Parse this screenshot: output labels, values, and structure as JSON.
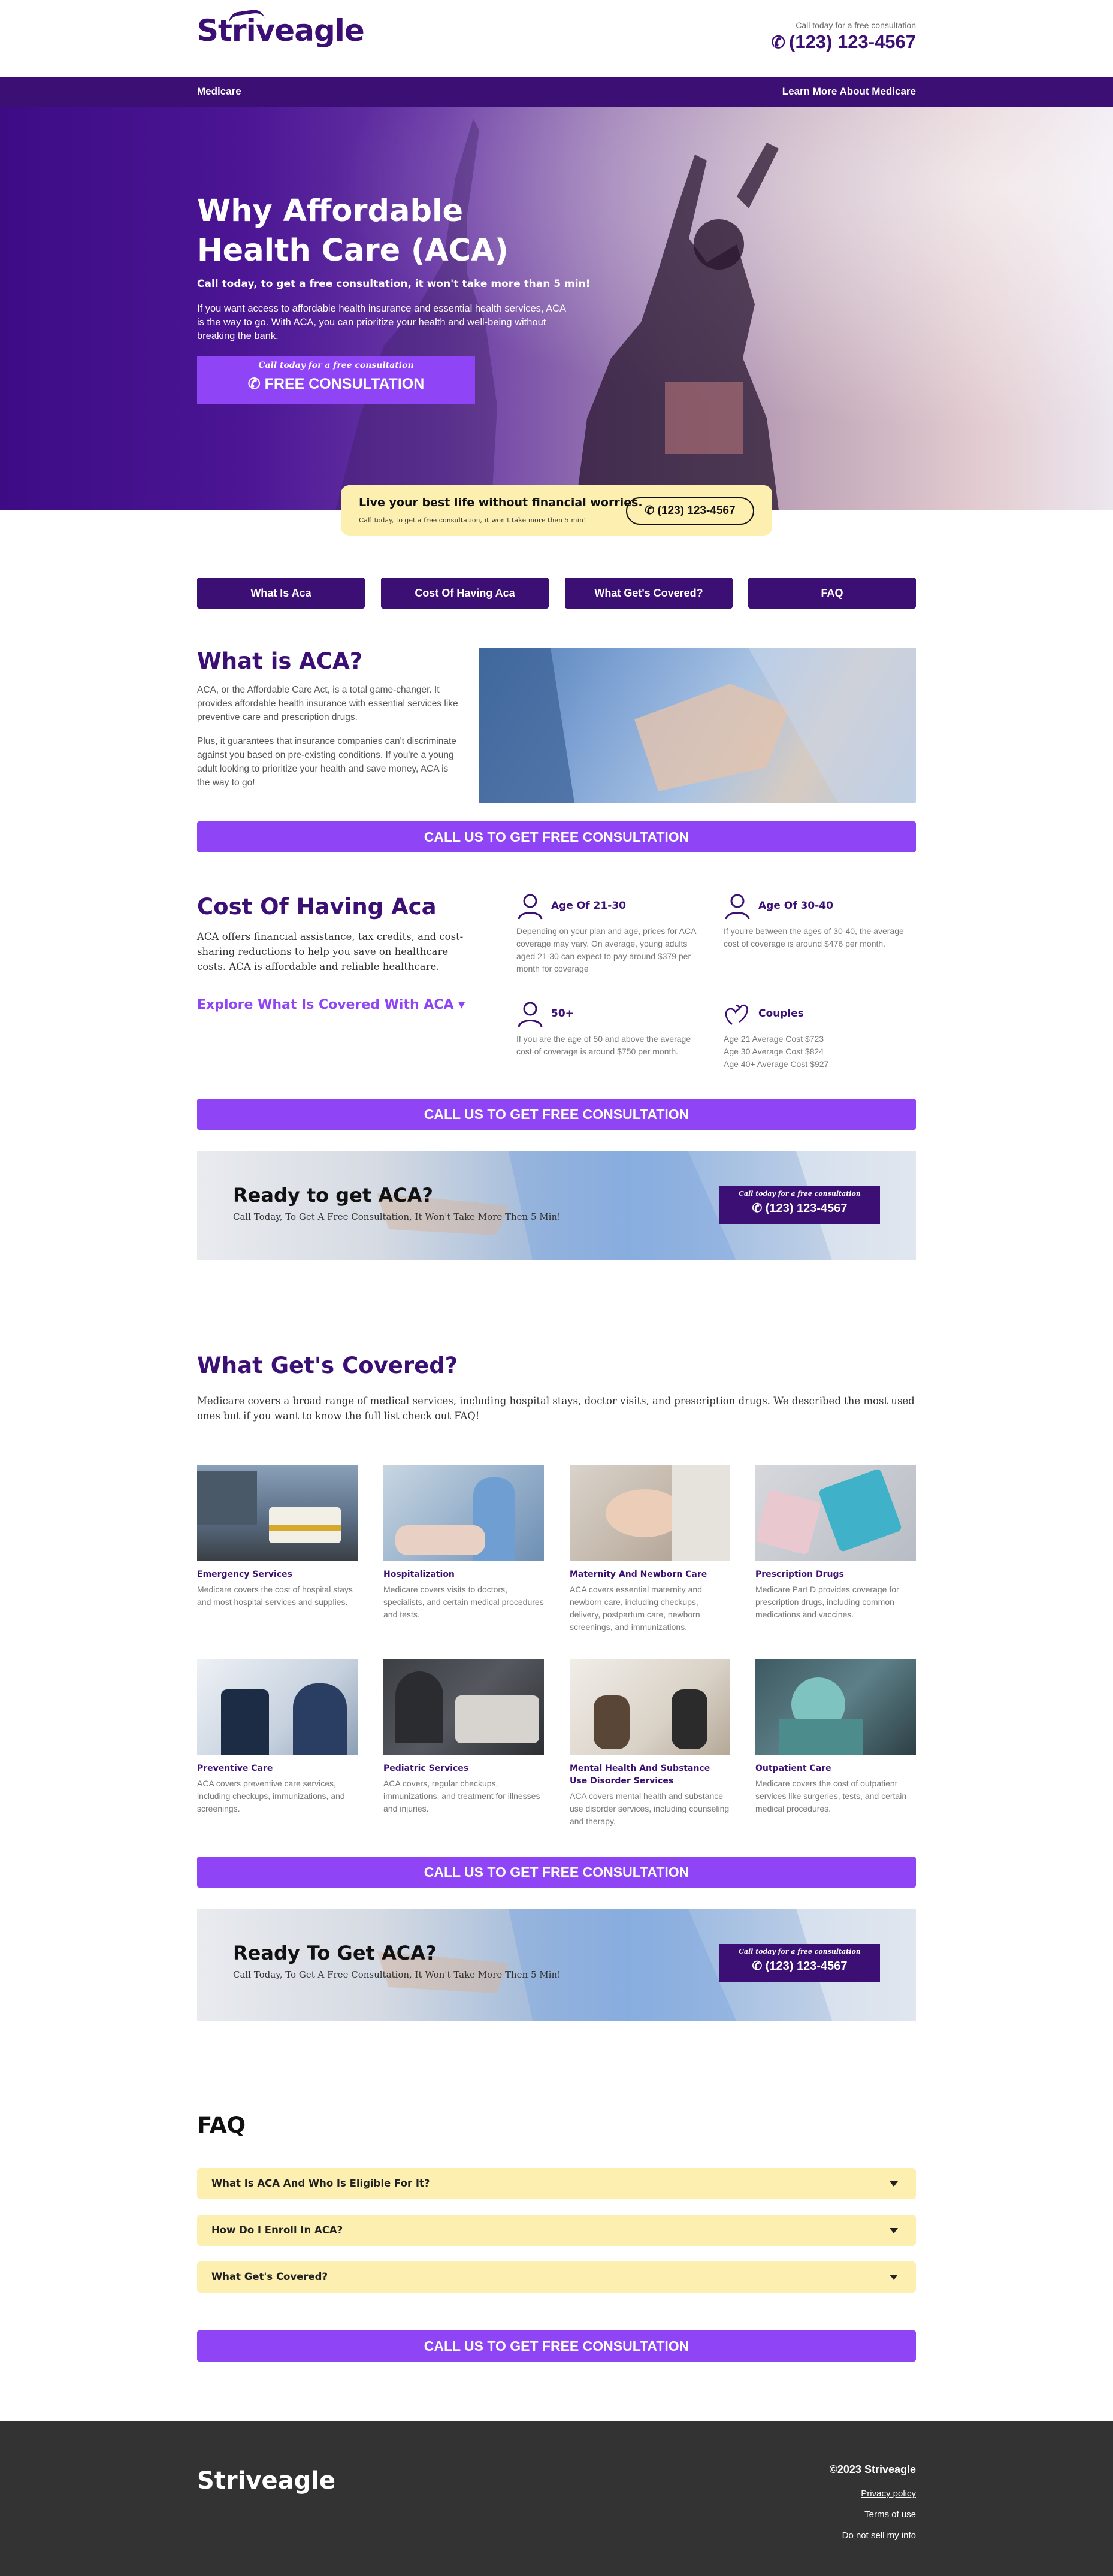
{
  "header": {
    "logo": "Striveagle",
    "call_text": "Call today for a free consultation",
    "phone": "(123) 123-4567"
  },
  "nav": {
    "left": "Medicare",
    "right": "Learn More About Medicare"
  },
  "hero": {
    "title": "Why Affordable Health Care (ACA)",
    "subtitle": "Call today, to get a free consultation, it won't take more than 5 min!",
    "body": "If you want access to affordable health insurance and essential health services, ACA is the way to go. With ACA, you can prioritize your health and well-being without breaking the bank.",
    "btn_top": "Call today for a free consultation",
    "btn_main": "FREE CONSULTATION"
  },
  "callout": {
    "title": "Live your best life without financial worries.",
    "sub": "Call today, to get a free consultation, it won't take more then 5 min!",
    "phone": "(123) 123-4567"
  },
  "tabs": [
    "What Is Aca",
    "Cost Of Having Aca",
    "What Get's Covered?",
    "FAQ"
  ],
  "what_is": {
    "title": "What is ACA?",
    "p1": "ACA, or the Affordable Care Act, is a total game-changer. It provides affordable health insurance with essential services like preventive care and prescription drugs.",
    "p2": "Plus, it guarantees that insurance companies can't discriminate against you based on pre-existing conditions. If you're a young adult looking to prioritize your health and save money, ACA is the way to go!"
  },
  "cta_label": "CALL US TO GET FREE CONSULTATION",
  "cost": {
    "title": "Cost Of Having Aca",
    "body": "ACA offers financial assistance, tax credits, and cost-sharing reductions to help you save on healthcare costs. ACA is affordable and reliable healthcare.",
    "explore": "Explore What Is Covered With ACA",
    "ages": [
      {
        "title": "Age Of 21-30",
        "desc": "Depending on your plan and age, prices for ACA coverage may vary. On average, young adults aged 21-30 can expect to pay around $379 per month for coverage",
        "icon": "person-icon"
      },
      {
        "title": "Age Of 30-40",
        "desc": "If you're between the ages of 30-40, the average cost of coverage is around $476 per month.",
        "icon": "person-icon"
      },
      {
        "title": "50+",
        "desc": "If you are the age of 50 and above the average cost of coverage is around $750 per month.",
        "icon": "person-icon"
      },
      {
        "title": "Couples",
        "desc1": "Age 21 Average Cost $723",
        "desc2": "Age 30 Average Cost $824",
        "desc3": "Age 40+ Average Cost $927",
        "icon": "hearts-icon"
      }
    ]
  },
  "banner1": {
    "title": "Ready to get ACA?",
    "sub": "Call Today, To Get A Free Consultation, It Won't Take More Then 5 Min!",
    "btn_top": "Call today for a free consultation",
    "btn_phone": "(123) 123-4567"
  },
  "covered": {
    "title": "What Get's Covered?",
    "body": "Medicare covers a broad range of medical services, including hospital stays, doctor visits, and prescription drugs. We described the most used ones but if you want to know the full list check out FAQ!",
    "items": [
      {
        "title": "Emergency Services",
        "desc": "Medicare covers the cost of hospital stays and most hospital services and supplies."
      },
      {
        "title": "Hospitalization",
        "desc": "Medicare covers visits to doctors, specialists, and certain medical procedures and tests."
      },
      {
        "title": "Maternity And Newborn Care",
        "desc": "ACA covers essential maternity and newborn care, including checkups, delivery, postpartum care, newborn screenings, and immunizations."
      },
      {
        "title": "Prescription Drugs",
        "desc": "Medicare Part D provides coverage for prescription drugs, including common medications and vaccines."
      },
      {
        "title": "Preventive Care",
        "desc": "ACA covers preventive care services, including checkups, immunizations, and screenings."
      },
      {
        "title": "Pediatric Services",
        "desc": "ACA covers, regular checkups, immunizations, and treatment for illnesses and injuries."
      },
      {
        "title": "Mental Health And Substance Use Disorder Services",
        "desc": "ACA covers mental health and substance use disorder services, including counseling and therapy."
      },
      {
        "title": "Outpatient Care",
        "desc": "Medicare covers the cost of outpatient services like surgeries, tests, and certain medical procedures."
      }
    ]
  },
  "banner2": {
    "title": "Ready To Get ACA?",
    "sub": "Call Today, To Get A Free Consultation, It Won't Take More Then 5 Min!",
    "btn_top": "Call today for a free consultation",
    "btn_phone": "(123) 123-4567"
  },
  "faq": {
    "title": "FAQ",
    "items": [
      "What Is ACA And Who Is Eligible For It?",
      "How Do I Enroll In ACA?",
      "What Get's Covered?"
    ]
  },
  "footer": {
    "logo": "Striveagle",
    "copyright": "©2023 Striveagle",
    "links": [
      "Privacy policy",
      "Terms of use",
      "Do not sell my info"
    ]
  },
  "colors": {
    "brand_purple": "#3b0f73",
    "cta_purple": "#8f45f5",
    "callout_yellow": "#fcefb0",
    "footer_gray": "#333333"
  }
}
